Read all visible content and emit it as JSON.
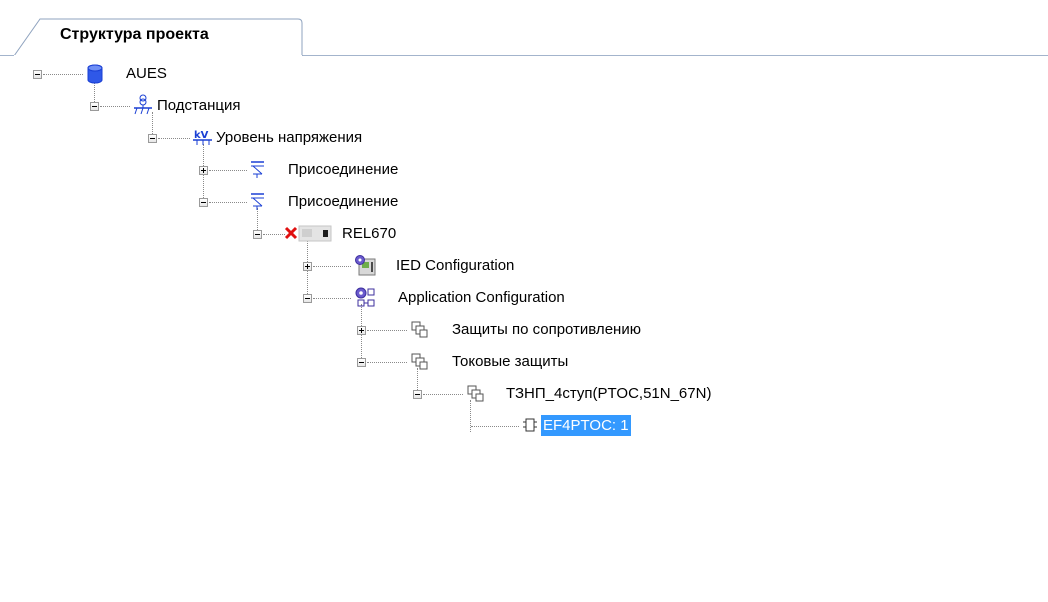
{
  "tab": {
    "title": "Структура проекта"
  },
  "tree": {
    "root": "AUES",
    "substation": "Подстанция",
    "voltage_level": "Уровень напряжения",
    "bay_1": "Присоединение",
    "bay_2": "Присоединение",
    "ied": "REL670",
    "ied_config": "IED Configuration",
    "app_config": "Application Configuration",
    "distance_protection": "Защиты по сопротивлению",
    "current_protection": "Токовые защиты",
    "function_group": "ТЗНП_4ступ(PTOC,51N_67N)",
    "function_block": "EF4PTOC: 1"
  },
  "colors": {
    "selection": "#3399ff",
    "icon_blue": "#1a3fd4",
    "error_red": "#e01010"
  }
}
